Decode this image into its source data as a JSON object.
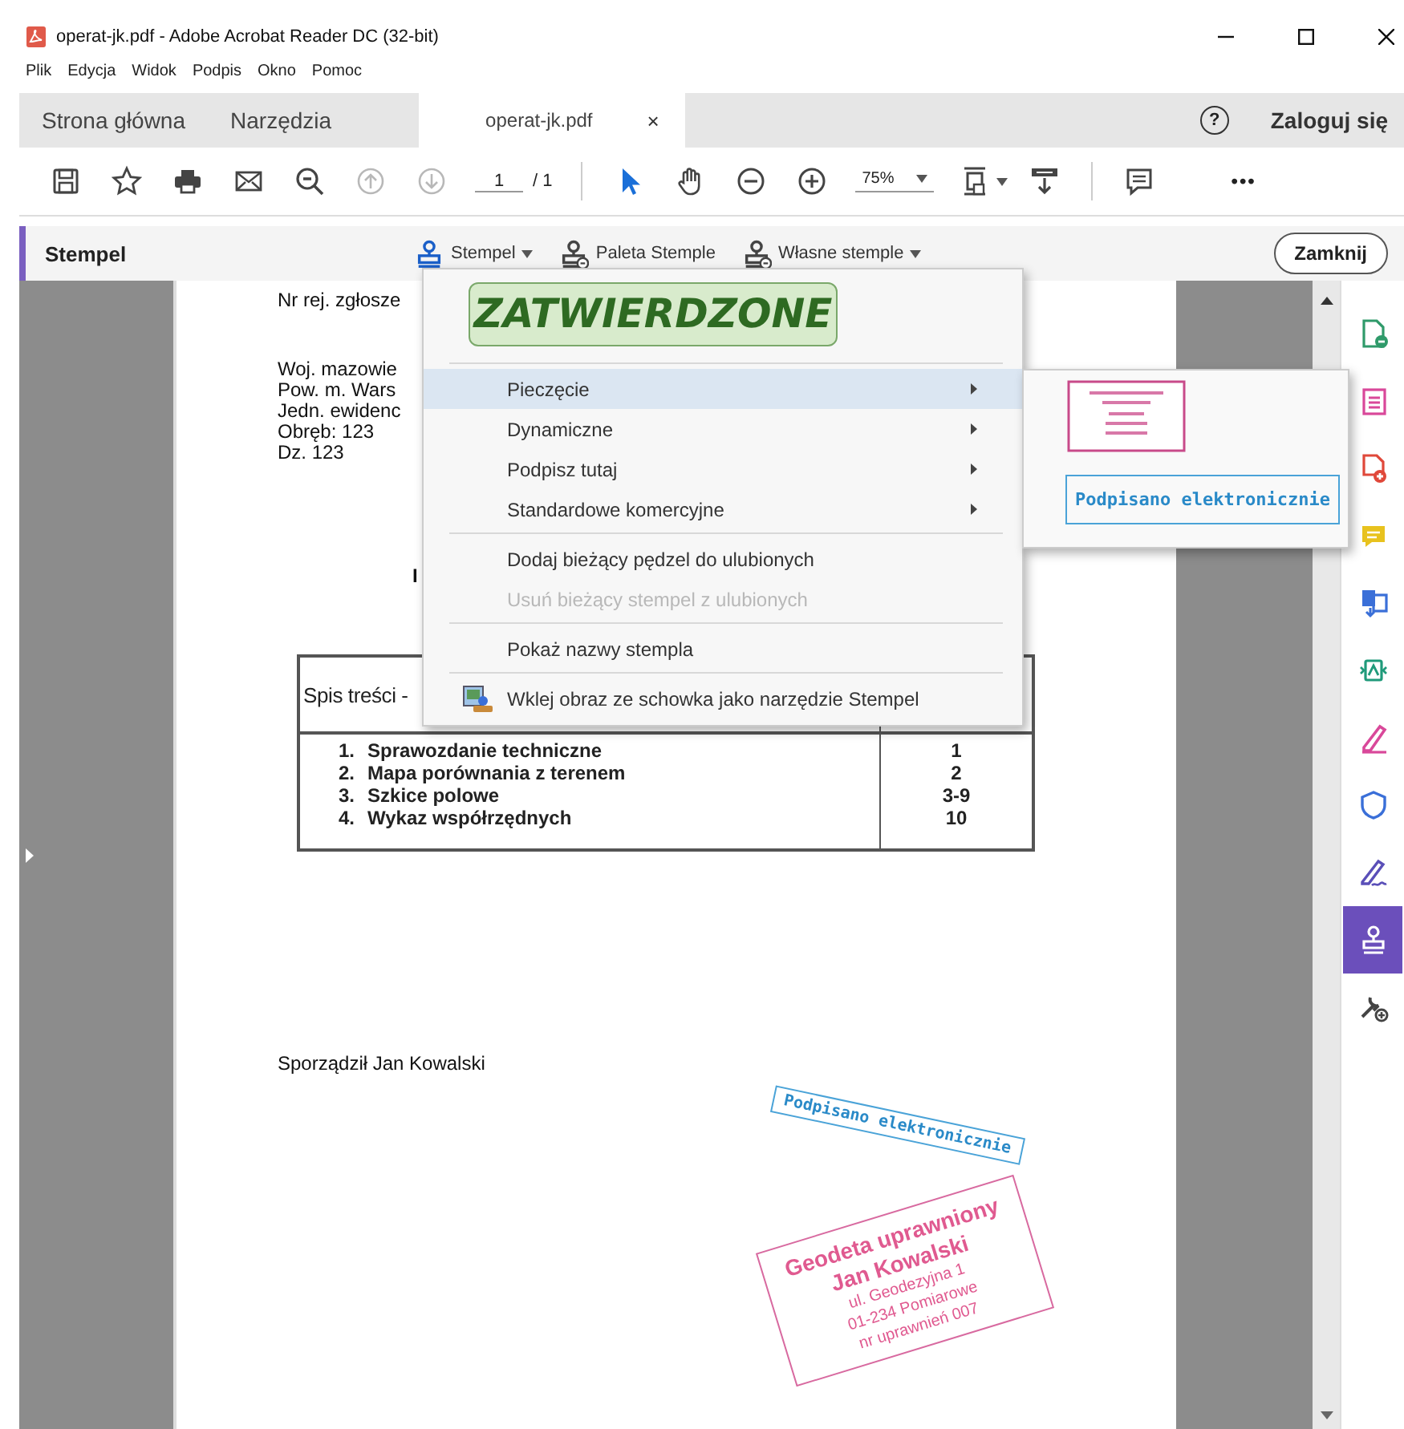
{
  "window": {
    "title": "operat-jk.pdf - Adobe Acrobat Reader DC (32-bit)",
    "menu": [
      "Plik",
      "Edycja",
      "Widok",
      "Podpis",
      "Okno",
      "Pomoc"
    ]
  },
  "tabs": [
    {
      "label": "Strona główna",
      "selected": false
    },
    {
      "label": "Narzędzia",
      "selected": false
    },
    {
      "label": "operat-jk.pdf",
      "selected": true,
      "close": "×"
    }
  ],
  "account": {
    "help": "?",
    "login": "Zaloguj się"
  },
  "toolbar": {
    "groups": [
      [
        {
          "kind": "button",
          "disabled": false,
          "selected": false
        },
        {
          "kind": "button",
          "disabled": false,
          "selected": false
        },
        {
          "kind": "button",
          "disabled": false,
          "selected": false
        },
        {
          "kind": "button",
          "disabled": false,
          "selected": false
        },
        {
          "kind": "button",
          "disabled": false,
          "selected": false
        },
        {
          "kind": "button",
          "disabled": true,
          "selected": false
        },
        {
          "kind": "button",
          "disabled": true,
          "selected": false
        },
        {
          "kind": "page",
          "value": "1",
          "total": "/ 1"
        }
      ],
      [
        {
          "kind": "button",
          "disabled": false,
          "selected": true
        },
        {
          "kind": "button",
          "disabled": false,
          "selected": false
        },
        {
          "kind": "button",
          "disabled": false,
          "selected": false
        },
        {
          "kind": "button",
          "disabled": false,
          "selected": false
        },
        {
          "kind": "zoom",
          "value": "75%"
        },
        {
          "kind": "menu-button",
          "disabled": false,
          "selected": false
        },
        {
          "kind": "button",
          "disabled": false,
          "selected": false
        }
      ],
      [
        {
          "kind": "button",
          "disabled": false,
          "selected": false
        },
        {
          "kind": "more",
          "label": "•••"
        }
      ]
    ]
  },
  "stamp_bar": {
    "title": "Stempel",
    "tools": [
      {
        "label": "Stempel",
        "dropdown": true,
        "kind": "stamp"
      },
      {
        "label": "Paleta Stemple",
        "dropdown": false,
        "kind": "palette"
      },
      {
        "label": "Własne stemple",
        "dropdown": true,
        "kind": "palette"
      }
    ],
    "close": "Zamknij"
  },
  "stamp_menu": {
    "preview": "ZATWIERDZONE",
    "items": [
      {
        "kind": "submenu",
        "label": "Pieczęcie",
        "selected": true,
        "disabled": false
      },
      {
        "kind": "submenu",
        "label": "Dynamiczne",
        "selected": false,
        "disabled": false
      },
      {
        "kind": "submenu",
        "label": "Podpisz tutaj",
        "selected": false,
        "disabled": false
      },
      {
        "kind": "submenu",
        "label": "Standardowe komercyjne",
        "selected": false,
        "disabled": false
      },
      {
        "kind": "separator"
      },
      {
        "kind": "action",
        "label": "Dodaj bieżący pędzel do ulubionych",
        "selected": false,
        "disabled": false
      },
      {
        "kind": "action",
        "label": "Usuń bieżący stempel z ulubionych",
        "selected": false,
        "disabled": true
      },
      {
        "kind": "separator"
      },
      {
        "kind": "action",
        "label": "Pokaż nazwy stempla",
        "selected": false,
        "disabled": false
      },
      {
        "kind": "separator"
      },
      {
        "kind": "paste",
        "label": "Wklej obraz ze schowka jako narzędzie Stempel",
        "selected": false,
        "disabled": false
      }
    ]
  },
  "submenu": {
    "stamps": [
      {
        "kind": "image"
      },
      {
        "kind": "text",
        "text": "Podpisano elektronicznie"
      }
    ]
  },
  "document": {
    "registration": "Nr rej. zgłosze",
    "address": [
      "Woj. mazowie",
      "Pow. m. Wars",
      "Jedn. ewidenc",
      "Obręb: 123",
      "Dz. 123"
    ],
    "title_fragment": "I",
    "table": {
      "heading": "Spis treści -",
      "rows": [
        {
          "number": "1.",
          "title": "Sprawozdanie techniczne",
          "pages": "1"
        },
        {
          "number": "2.",
          "title": "Mapa porównania z terenem",
          "pages": "2"
        },
        {
          "number": "3.",
          "title": "Szkice polowe",
          "pages": "3-9"
        },
        {
          "number": "4.",
          "title": "Wykaz współrzędnych",
          "pages": "10"
        }
      ]
    },
    "author": "Sporządził Jan Kowalski",
    "stamps": [
      {
        "kind": "electronic",
        "lines": [
          "Podpisano elektronicznie"
        ]
      },
      {
        "kind": "surveyor",
        "lines": [
          "Geodeta uprawniony",
          "Jan Kowalski",
          "ul. Geodezyjna 1",
          "01-234 Pomiarowe",
          "nr uprawnień 007"
        ]
      }
    ]
  },
  "tool_rail": [
    {
      "color": "#2f9a6a",
      "selected": false
    },
    {
      "color": "#d9489a",
      "selected": false
    },
    {
      "color": "#e0483a",
      "selected": false
    },
    {
      "color": "#e8c21e",
      "selected": false
    },
    {
      "color": "#3a6fd8",
      "selected": false
    },
    {
      "color": "#1f9a7a",
      "selected": false
    },
    {
      "color": "#d9489a",
      "selected": false
    },
    {
      "color": "#3a6fd8",
      "selected": false
    },
    {
      "color": "#5a4fb8",
      "selected": false
    },
    {
      "color": "#6b4fbb",
      "selected": true
    },
    {
      "color": "#444444",
      "selected": false
    }
  ]
}
